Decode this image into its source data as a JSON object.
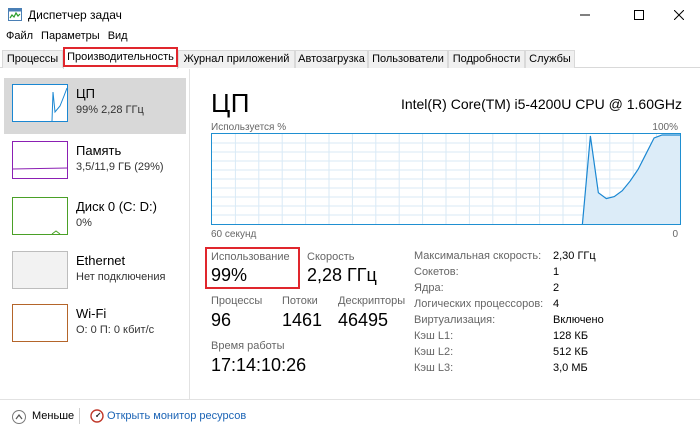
{
  "window": {
    "title": "Диспетчер задач"
  },
  "menu": [
    "Файл",
    "Параметры",
    "Вид"
  ],
  "tabs": [
    "Процессы",
    "Производительность",
    "Журнал приложений",
    "Автозагрузка",
    "Пользователи",
    "Подробности",
    "Службы"
  ],
  "active_tab": "Производительность",
  "sidebar": {
    "items": [
      {
        "name": "ЦП",
        "sub": "99% 2,28 ГГц",
        "color": "#1a87d2",
        "active": true
      },
      {
        "name": "Память",
        "sub": "3,5/11,9 ГБ (29%)",
        "color": "#8b1fb3",
        "active": false
      },
      {
        "name": "Диск 0 (C: D:)",
        "sub": "0%",
        "color": "#4aa027",
        "active": false
      },
      {
        "name": "Ethernet",
        "sub": "Нет подключения",
        "color": "#bdbdbd",
        "active": false
      },
      {
        "name": "Wi-Fi",
        "sub": "О: 0 П: 0 кбит/с",
        "color": "#b4652a",
        "active": false
      }
    ]
  },
  "cpu": {
    "title": "ЦП",
    "model": "Intel(R) Core(TM) i5-4200U CPU @ 1.60GHz",
    "graph_label": "Используется %",
    "graph_max": "100%",
    "graph_time": "60 секунд",
    "graph_min": "0",
    "usage_label": "Использование",
    "usage_value": "99%",
    "speed_label": "Скорость",
    "speed_value": "2,28 ГГц",
    "processes_label": "Процессы",
    "processes_value": "96",
    "threads_label": "Потоки",
    "threads_value": "1461",
    "handles_label": "Дескрипторы",
    "handles_value": "46495",
    "uptime_label": "Время работы",
    "uptime_value": "17:14:10:26"
  },
  "details": [
    {
      "label": "Максимальная скорость:",
      "value": "2,30 ГГц"
    },
    {
      "label": "Сокетов:",
      "value": "1"
    },
    {
      "label": "Ядра:",
      "value": "2"
    },
    {
      "label": "Логических процессоров:",
      "value": "4"
    },
    {
      "label": "Виртуализация:",
      "value": "Включено"
    },
    {
      "label": "Кэш L1:",
      "value": "128 КБ"
    },
    {
      "label": "Кэш L2:",
      "value": "512 КБ"
    },
    {
      "label": "Кэш L3:",
      "value": "3,0 МБ"
    }
  ],
  "footer": {
    "fewer_label": "Меньше",
    "monitor_link": "Открыть монитор ресурсов"
  },
  "colors": {
    "accent": "#1f8fd1",
    "highlight": "#e0262d",
    "link": "#1a63b5"
  }
}
